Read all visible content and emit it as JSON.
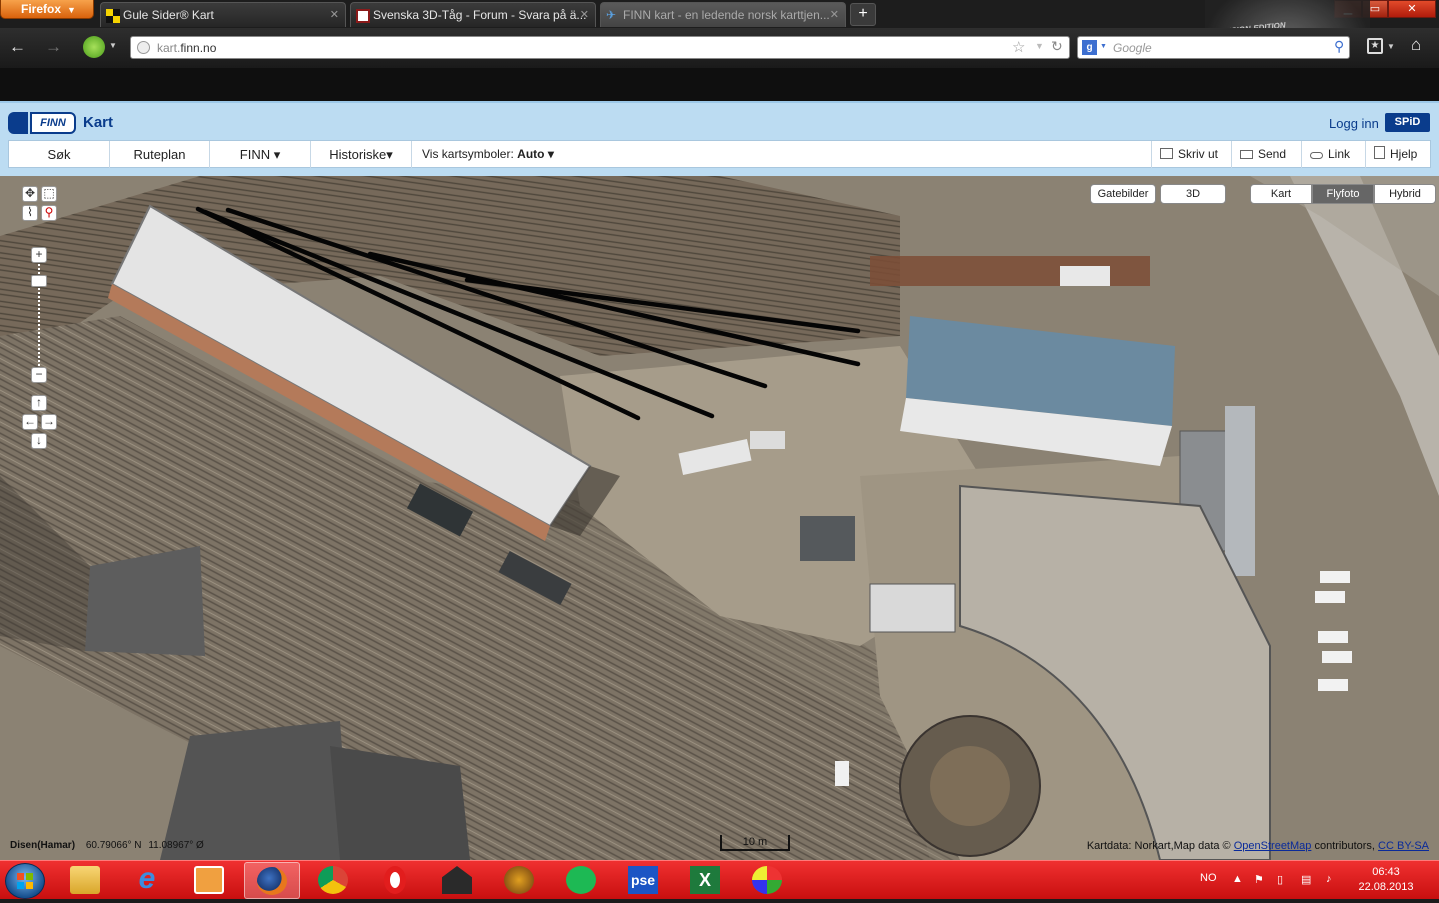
{
  "browser": {
    "menu_button": "Firefox",
    "tabs": [
      {
        "title": "Gule Sider® Kart"
      },
      {
        "title": "Svenska 3D-Tåg - Forum - Svara på ä..."
      },
      {
        "title": "FINN kart - en ledende norsk karttjen..."
      }
    ],
    "new_tab_label": "+",
    "url_prefix": "kart.",
    "url_domain": "finn.no",
    "search_placeholder": "Google",
    "skin_label": "DESIGN-EDITION"
  },
  "finn": {
    "logo_text": "FINN",
    "title": "Kart",
    "login": "Logg inn",
    "spid": "SPiD",
    "menu": [
      {
        "label": "Søk"
      },
      {
        "label": "Ruteplan"
      },
      {
        "label": "FINN ▾"
      },
      {
        "label": "Historiske▾"
      }
    ],
    "map_symbols_label": "Vis kartsymboler:",
    "map_symbols_value": "Auto ▾",
    "actions": [
      {
        "label": "Skriv ut",
        "icon": "printer-icon"
      },
      {
        "label": "Send",
        "icon": "envelope-icon"
      },
      {
        "label": "Link",
        "icon": "link-icon"
      },
      {
        "label": "Hjelp",
        "icon": "help-icon"
      }
    ]
  },
  "map": {
    "view_buttons": [
      {
        "label": "Gatebilder"
      },
      {
        "label": "3D"
      }
    ],
    "layer_buttons": [
      {
        "label": "Kart",
        "active": false
      },
      {
        "label": "Flyfoto",
        "active": true
      },
      {
        "label": "Hybrid",
        "active": false
      }
    ],
    "place": "Disen(Hamar)",
    "latitude": "60.79066° N",
    "longitude": "11.08967° Ø",
    "scale": "10 m",
    "attribution_prefix": "Kartdata: Norkart,Map data ©",
    "attribution_link": "OpenStreetMap",
    "attribution_mid": "contributors,",
    "attribution_license": "CC BY-SA"
  },
  "taskbar": {
    "language": "NO",
    "time": "06:43",
    "date": "22.08.2013",
    "apps": [
      {
        "name": "explorer-icon"
      },
      {
        "name": "internet-explorer-icon"
      },
      {
        "name": "media-player-icon"
      },
      {
        "name": "firefox-icon",
        "active": true
      },
      {
        "name": "chrome-icon"
      },
      {
        "name": "opera-icon"
      },
      {
        "name": "train-app-icon"
      },
      {
        "name": "steam-engine-app-icon"
      },
      {
        "name": "spotify-icon"
      },
      {
        "name": "pse-icon",
        "label": "pse"
      },
      {
        "name": "excel-icon"
      },
      {
        "name": "paint-icon"
      }
    ]
  },
  "colors": {
    "finn_blue": "#0a3c8c",
    "finn_header_bg": "#bcdcf2",
    "taskbar_red": "#d81818",
    "firefox_orange": "#e8771c"
  }
}
